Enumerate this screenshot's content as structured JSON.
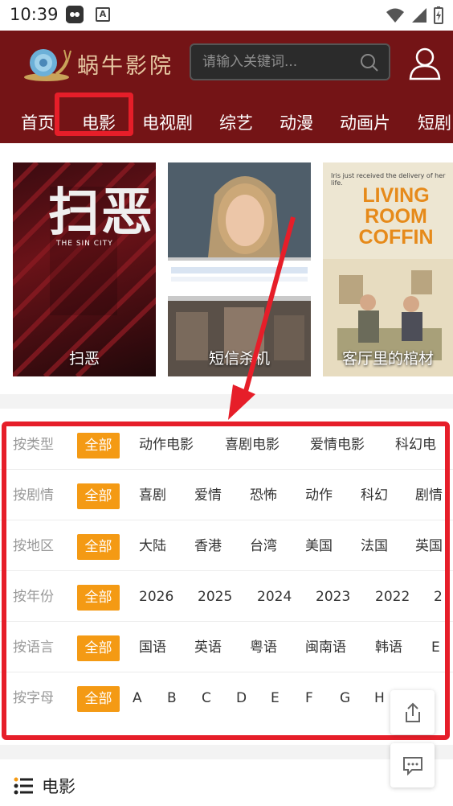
{
  "status": {
    "time": "10:39"
  },
  "header": {
    "logo_text": "蜗牛影院",
    "search_placeholder": "请输入关键词..."
  },
  "nav": {
    "items": [
      {
        "label": "首页",
        "active": false
      },
      {
        "label": "电影",
        "active": true
      },
      {
        "label": "电视剧",
        "active": false
      },
      {
        "label": "综艺",
        "active": false
      },
      {
        "label": "动漫",
        "active": false
      },
      {
        "label": "动画片",
        "active": false
      },
      {
        "label": "短剧",
        "active": false
      }
    ]
  },
  "posters": [
    {
      "caption": "扫恶",
      "title_big": "扫恶",
      "subtitle": "THE SIN CITY"
    },
    {
      "caption": "短信杀机"
    },
    {
      "caption": "客厅里的棺材",
      "title_big": "LIVING ROOM COFFIN",
      "tagline": "Iris just received the delivery of her life."
    }
  ],
  "filters": [
    {
      "label": "按类型",
      "all": "全部",
      "options": [
        "动作电影",
        "喜剧电影",
        "爱情电影",
        "科幻电"
      ]
    },
    {
      "label": "按剧情",
      "all": "全部",
      "options": [
        "喜剧",
        "爱情",
        "恐怖",
        "动作",
        "科幻",
        "剧情"
      ]
    },
    {
      "label": "按地区",
      "all": "全部",
      "options": [
        "大陆",
        "香港",
        "台湾",
        "美国",
        "法国",
        "英国"
      ]
    },
    {
      "label": "按年份",
      "all": "全部",
      "options": [
        "2026",
        "2025",
        "2024",
        "2023",
        "2022",
        "2"
      ]
    },
    {
      "label": "按语言",
      "all": "全部",
      "options": [
        "国语",
        "英语",
        "粤语",
        "闽南语",
        "韩语",
        "E"
      ]
    },
    {
      "label": "按字母",
      "all": "全部",
      "options": [
        "A",
        "B",
        "C",
        "D",
        "E",
        "F",
        "G",
        "H"
      ]
    }
  ],
  "section": {
    "title": "电影"
  },
  "colors": {
    "header": "#741416",
    "accent": "#f49a14",
    "highlight": "#e61e29"
  }
}
